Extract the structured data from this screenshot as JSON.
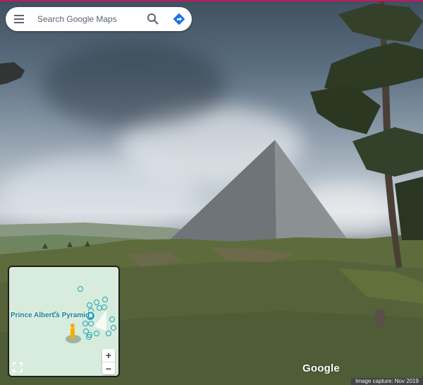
{
  "search": {
    "placeholder": "Search Google Maps",
    "menu_icon": "hamburger-menu-icon",
    "search_icon": "search-icon",
    "directions_icon": "directions-icon"
  },
  "minimap": {
    "place_label": "Prince Albert's Pyramid",
    "zoom_in_label": "+",
    "zoom_out_label": "−",
    "accent_color": "#1aa6b7"
  },
  "watermark": {
    "logo": "Google",
    "capture_date": "Image capture: Nov 2019"
  }
}
